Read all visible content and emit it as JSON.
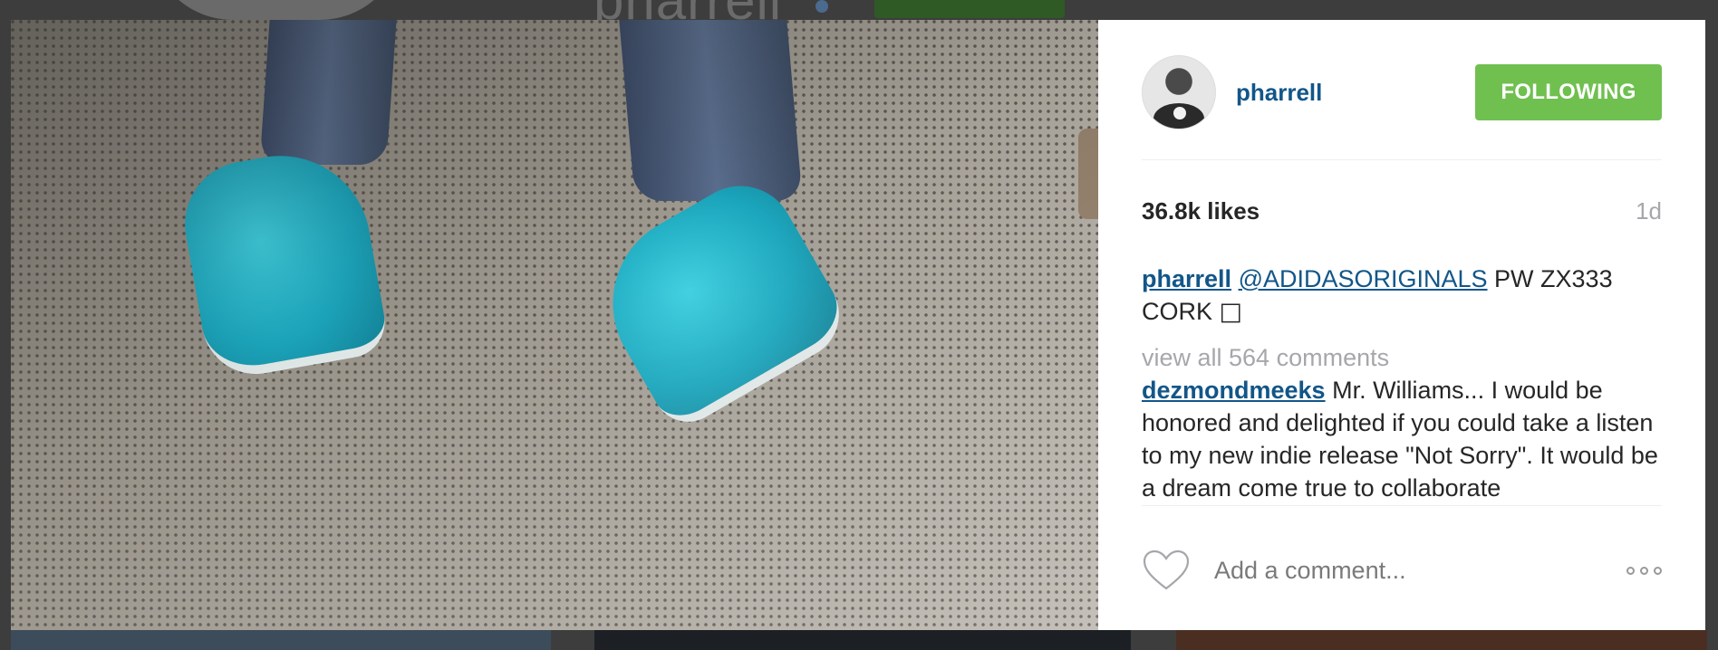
{
  "background_page": {
    "title": "pharrell"
  },
  "post": {
    "author": {
      "username": "pharrell"
    },
    "follow_button_label": "FOLLOWING",
    "likes_text": "36.8k likes",
    "time_ago": "1d",
    "caption": {
      "username": "pharrell",
      "mention": "@ADIDASORIGINALS",
      "text": " PW ZX333 CORK ",
      "trailing_glyph": "□"
    },
    "view_all_comments": "view all 564 comments",
    "comments": [
      {
        "username": "dezmondmeeks",
        "text": " Mr. Williams... I would be honored and delighted if you could take a listen to my new indie release \"Not Sorry\". It would be a dream come true to collaborate"
      }
    ],
    "add_comment_placeholder": "Add a comment...",
    "icons": {
      "like": "heart-icon",
      "more": "more-options-icon"
    }
  },
  "colors": {
    "link_blue": "#125688",
    "following_green": "#70c050",
    "muted_gray": "#a5a7aa"
  }
}
